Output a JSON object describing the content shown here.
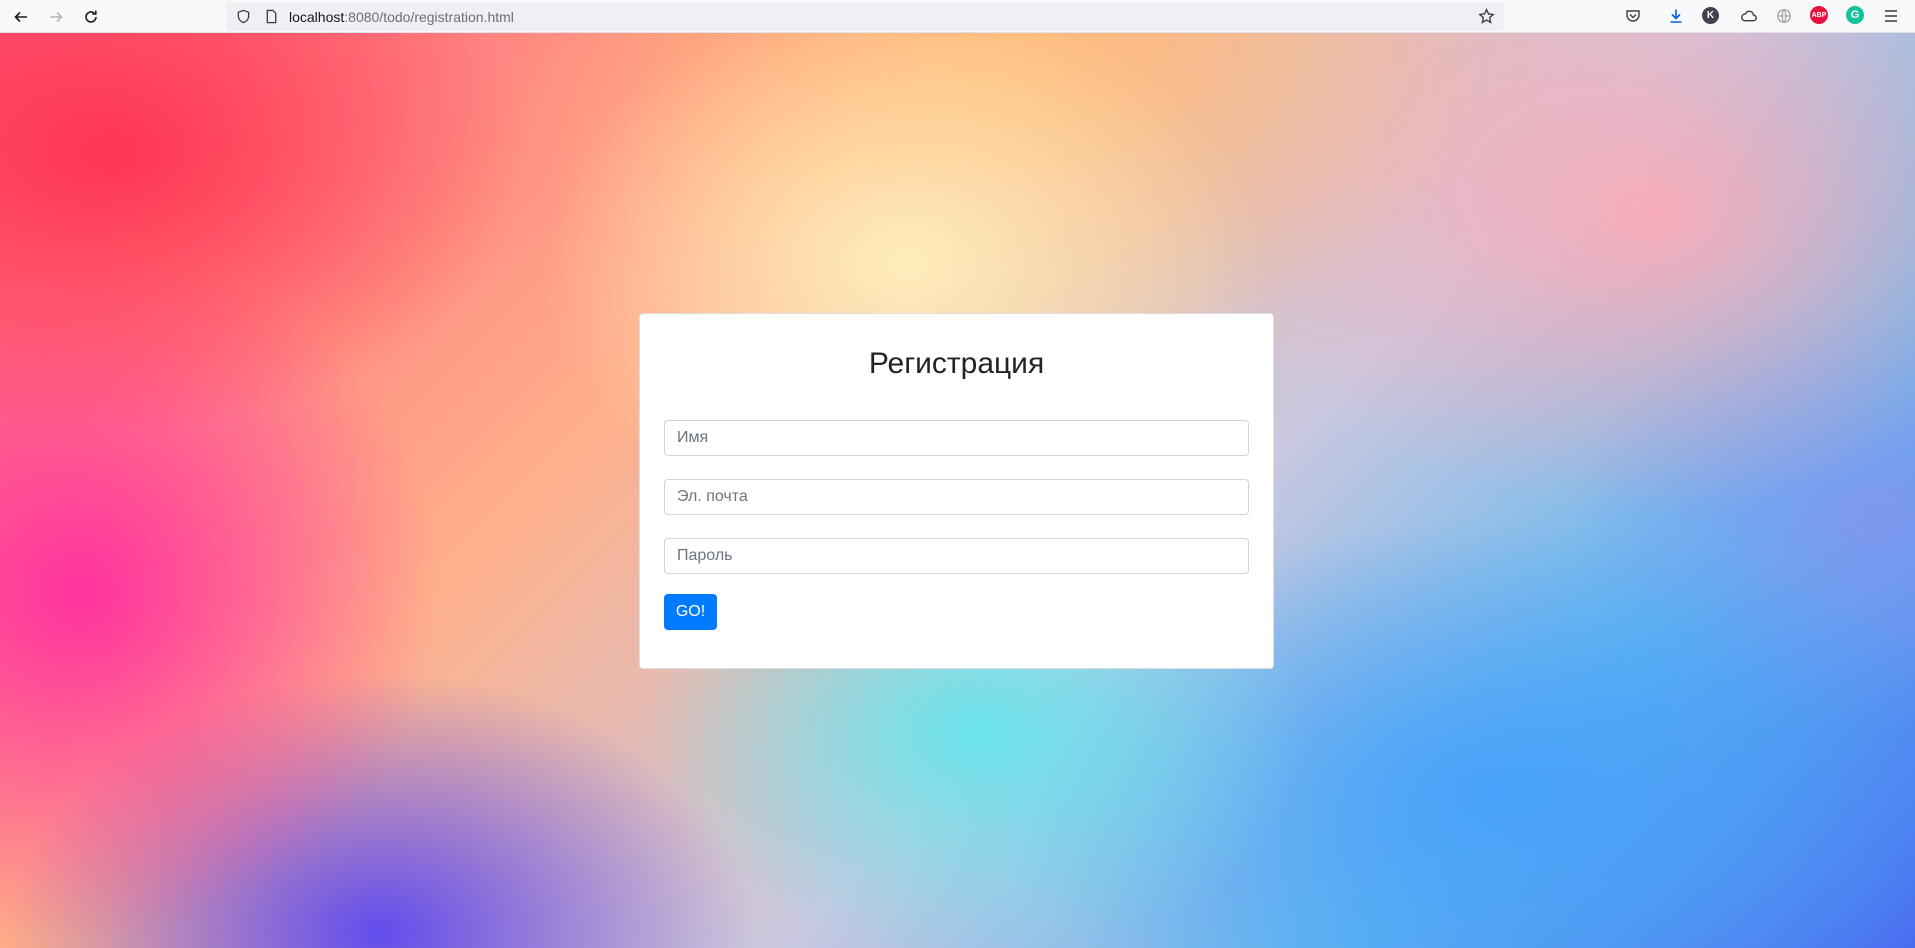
{
  "browser": {
    "url_host": "localhost",
    "url_rest": ":8080/todo/registration.html",
    "icons": {
      "back": "back-arrow-icon",
      "forward": "forward-arrow-icon",
      "reload": "reload-icon",
      "shield": "tracking-protection-shield-icon",
      "page": "page-info-icon",
      "bookmark": "bookmark-star-icon"
    },
    "extensions": {
      "k_label": "K",
      "abp_label": "ABP",
      "g_label": "G"
    }
  },
  "form": {
    "title": "Регистрация",
    "name_placeholder": "Имя",
    "email_placeholder": "Эл. почта",
    "password_placeholder": "Пароль",
    "submit_label": "GO!"
  },
  "colors": {
    "primary_button": "#007bff",
    "card_background": "#ffffff"
  }
}
